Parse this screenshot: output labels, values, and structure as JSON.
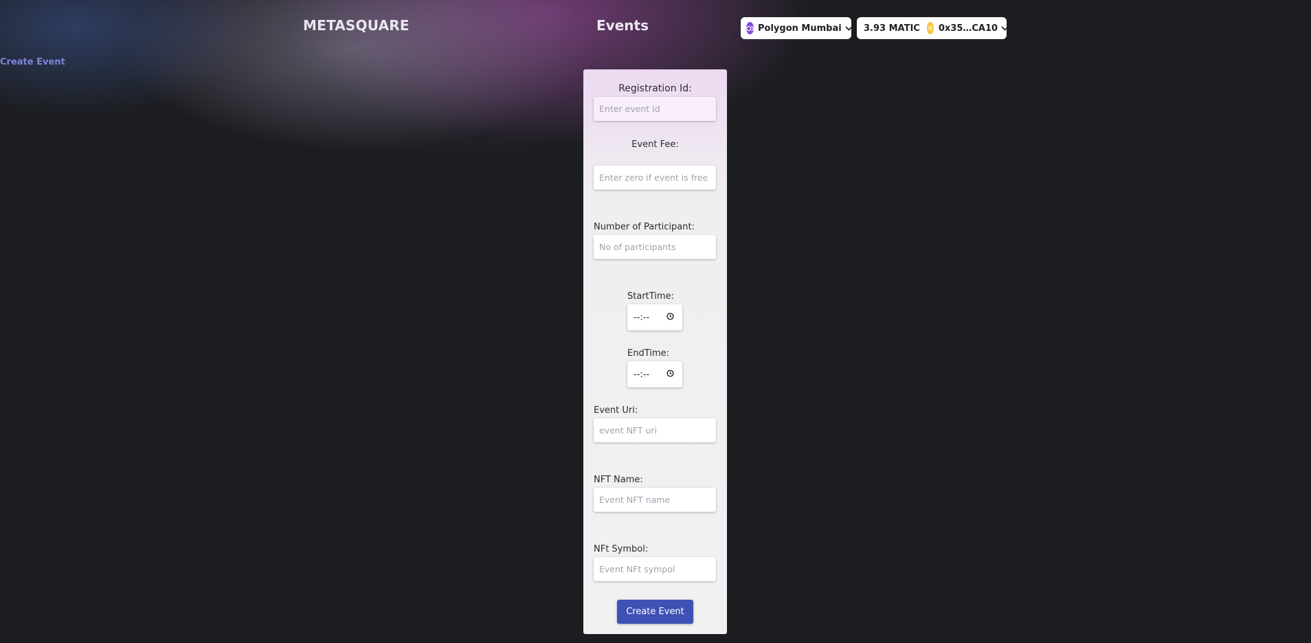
{
  "header": {
    "brand": "METASQUARE",
    "title": "Events",
    "network": {
      "label": "Polygon Mumbai",
      "icon": "polygon-icon"
    },
    "wallet": {
      "balance": "3.93 MATIC",
      "address": "0x35…CA10",
      "icon": "avatar-icon"
    }
  },
  "nav": {
    "create_event": "Create Event"
  },
  "form": {
    "registration_id": {
      "label": "Registration Id:",
      "placeholder": "Enter event Id",
      "value": ""
    },
    "event_fee": {
      "label": "Event Fee:",
      "placeholder": "Enter zero if event is free",
      "value": ""
    },
    "participants": {
      "label": "Number of Participant:",
      "placeholder": "No of participants",
      "value": ""
    },
    "start_time": {
      "label": "StartTime:",
      "value": "--:--"
    },
    "end_time": {
      "label": "EndTime:",
      "value": "--:--"
    },
    "event_uri": {
      "label": "Event Uri:",
      "placeholder": "event NFT uri",
      "value": ""
    },
    "nft_name": {
      "label": "NFT Name:",
      "placeholder": "Event NFT name",
      "value": ""
    },
    "nft_symbol": {
      "label": "NFt Symbol:",
      "placeholder": "Event NFt sympol",
      "value": ""
    },
    "submit_label": "Create Event"
  },
  "colors": {
    "background": "#1c1d21",
    "accent": "#3f51b5",
    "link": "#7c87d6",
    "polygon": "#8247e5",
    "avatar": "#f5c542"
  }
}
